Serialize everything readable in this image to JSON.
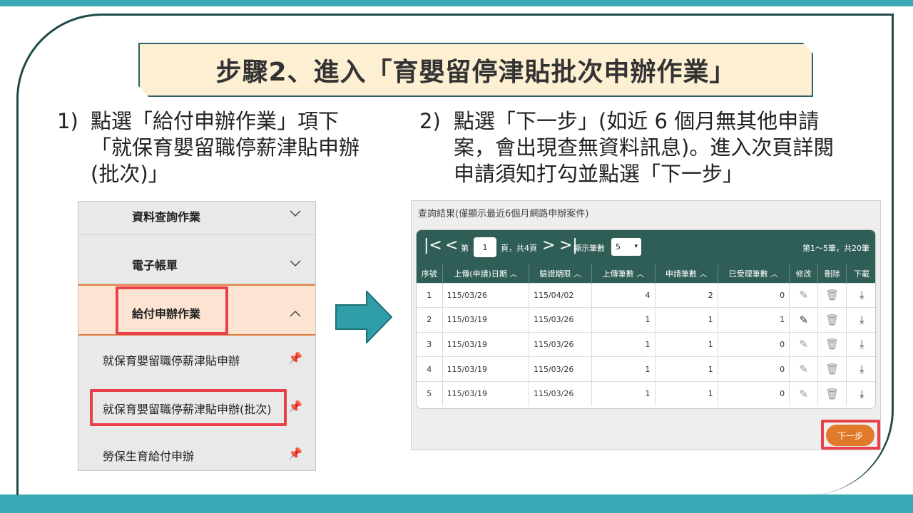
{
  "title": "步驟2、進入「育嬰留停津貼批次申辦作業」",
  "step1": {
    "num": "1)",
    "text": "點選「給付申辦作業」項下「就保育嬰留職停薪津貼申辦(批次)」"
  },
  "step2": {
    "num": "2)",
    "text": "點選「下一步」(如近 6 個月無其他申請案，會出現查無資料訊息)。進入次頁詳閱申請須知打勾並點選「下一步」"
  },
  "menu": {
    "items": [
      {
        "label": "資料查詢作業"
      },
      {
        "label": "電子帳單"
      },
      {
        "label": "給付申辦作業"
      }
    ],
    "sub_items": [
      {
        "label": "就保育嬰留職停薪津貼申辦"
      },
      {
        "label": "就保育嬰留職停薪津貼申辦(批次)"
      },
      {
        "label": "勞保生育給付申辦"
      }
    ]
  },
  "panel": {
    "title": "查詢結果(僅顯示最近6個月網路申辦案件)",
    "page_prefix": "第",
    "page": "1",
    "page_suffix": "頁，共4頁",
    "per_page_label": "顯示筆數",
    "per_page": "5",
    "range_text": "第1～5筆，共20筆",
    "columns": [
      "序號",
      "上傳(申請)日期",
      "驗證期限",
      "上傳筆數",
      "申請筆數",
      "已受理筆數",
      "修改",
      "刪除",
      "下載"
    ],
    "rows": [
      [
        "1",
        "115/03/26",
        "115/04/02",
        "4",
        "2",
        "0"
      ],
      [
        "2",
        "115/03/19",
        "115/03/26",
        "1",
        "1",
        "1"
      ],
      [
        "3",
        "115/03/19",
        "115/03/26",
        "1",
        "1",
        "0"
      ],
      [
        "4",
        "115/03/19",
        "115/03/26",
        "1",
        "1",
        "0"
      ],
      [
        "5",
        "115/03/19",
        "115/03/26",
        "1",
        "1",
        "0"
      ]
    ],
    "next_button": "下一步"
  },
  "colors": {
    "accent": "#3aabb6",
    "header": "#2f5e57",
    "highlight": "#e8414a",
    "button": "#e07a2a"
  }
}
